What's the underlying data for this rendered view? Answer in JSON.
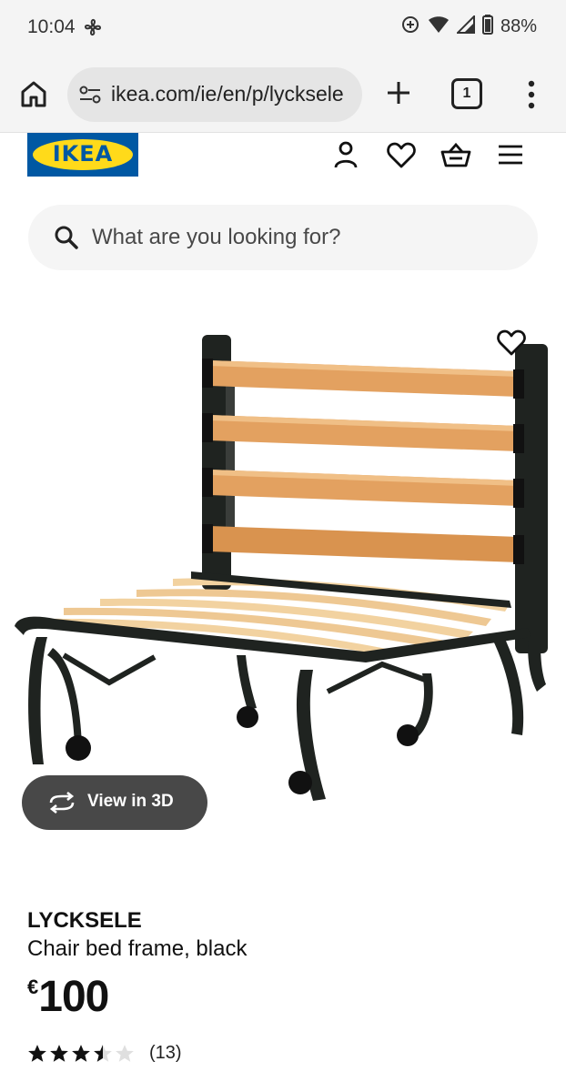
{
  "status_bar": {
    "time": "10:04",
    "battery": "88%"
  },
  "browser": {
    "url": "ikea.com/ie/en/p/lycksele",
    "tab_count": "1"
  },
  "site": {
    "logo_text": "IKEA",
    "brand_colors": {
      "blue": "#0058a3",
      "yellow": "#ffda1a"
    },
    "header_icons": [
      "profile-icon",
      "heart-icon",
      "basket-icon",
      "menu-icon"
    ]
  },
  "search": {
    "placeholder": "What are you looking for?"
  },
  "product": {
    "name": "LYCKSELE",
    "description": "Chair bed frame, black",
    "currency": "€",
    "price": "100",
    "rating": 3.5,
    "rating_max": 5,
    "review_count": "(13)",
    "view_3d_label": "View in 3D"
  }
}
